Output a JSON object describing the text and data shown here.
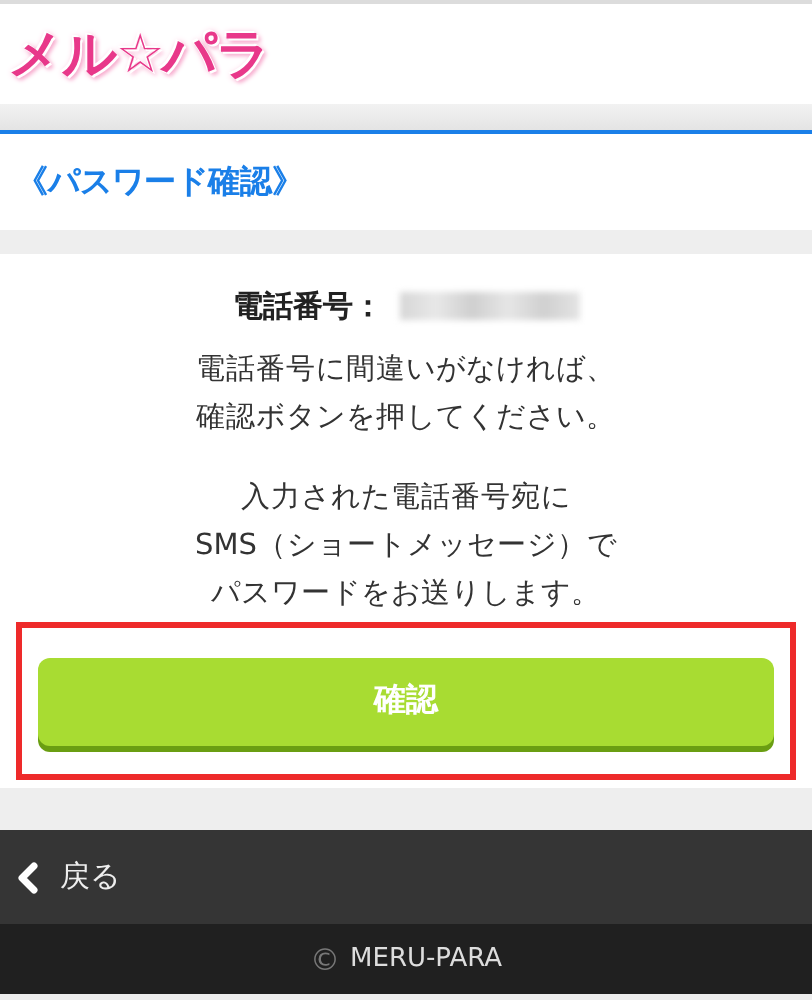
{
  "logo": {
    "text": "メル☆パラ"
  },
  "page_title": "《パスワード確認》",
  "phone": {
    "label": "電話番号：",
    "masked": true
  },
  "paragraphs": [
    [
      "電話番号に間違いがなければ、",
      "確認ボタンを押してください。"
    ],
    [
      "入力された電話番号宛に",
      "SMS（ショートメッセージ）で",
      "パスワードをお送りします。"
    ]
  ],
  "confirm_button": {
    "label": "確認",
    "highlighted": true
  },
  "back_link": "戻る",
  "footer": {
    "copyright_mark": "©",
    "text": "MERU-PARA"
  }
}
